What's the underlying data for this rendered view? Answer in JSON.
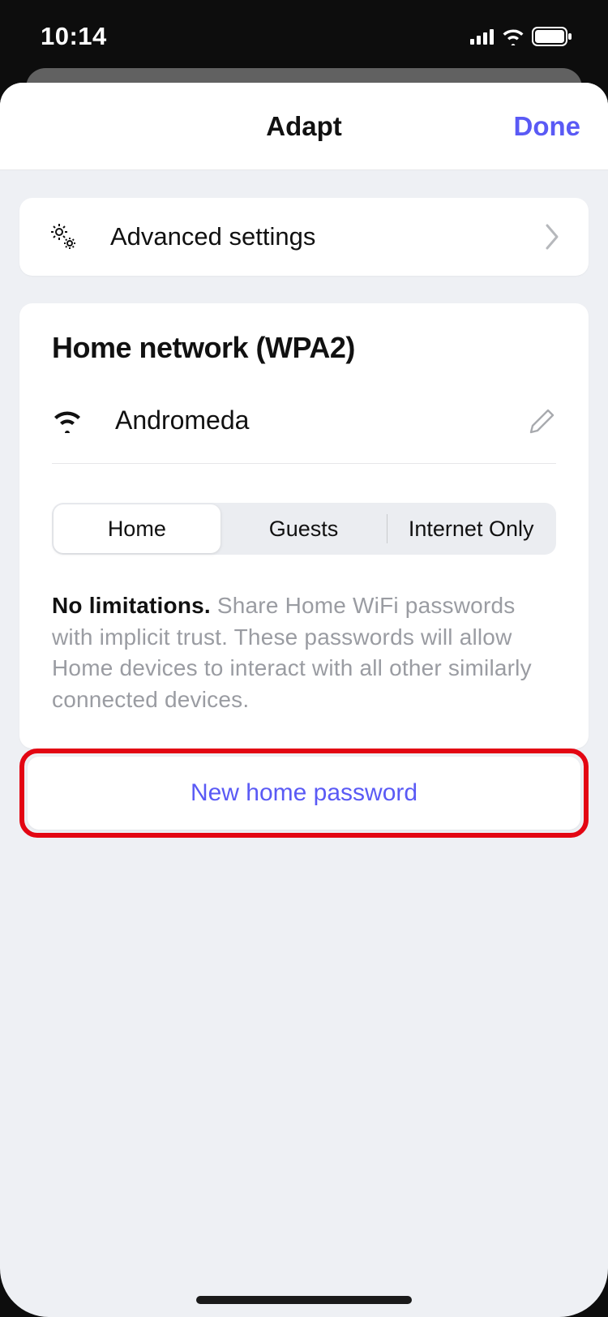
{
  "statusbar": {
    "time": "10:14"
  },
  "nav": {
    "title": "Adapt",
    "done": "Done"
  },
  "advanced": {
    "label": "Advanced settings"
  },
  "network": {
    "title": "Home network (WPA2)",
    "ssid": "Andromeda"
  },
  "tabs": {
    "home": "Home",
    "guests": "Guests",
    "internet_only": "Internet Only"
  },
  "description": {
    "strong": "No limitations.",
    "rest": " Share Home WiFi passwords with implicit trust. These passwords will allow Home devices to interact with all other similarly connected devices."
  },
  "new_password_label": "New home password"
}
